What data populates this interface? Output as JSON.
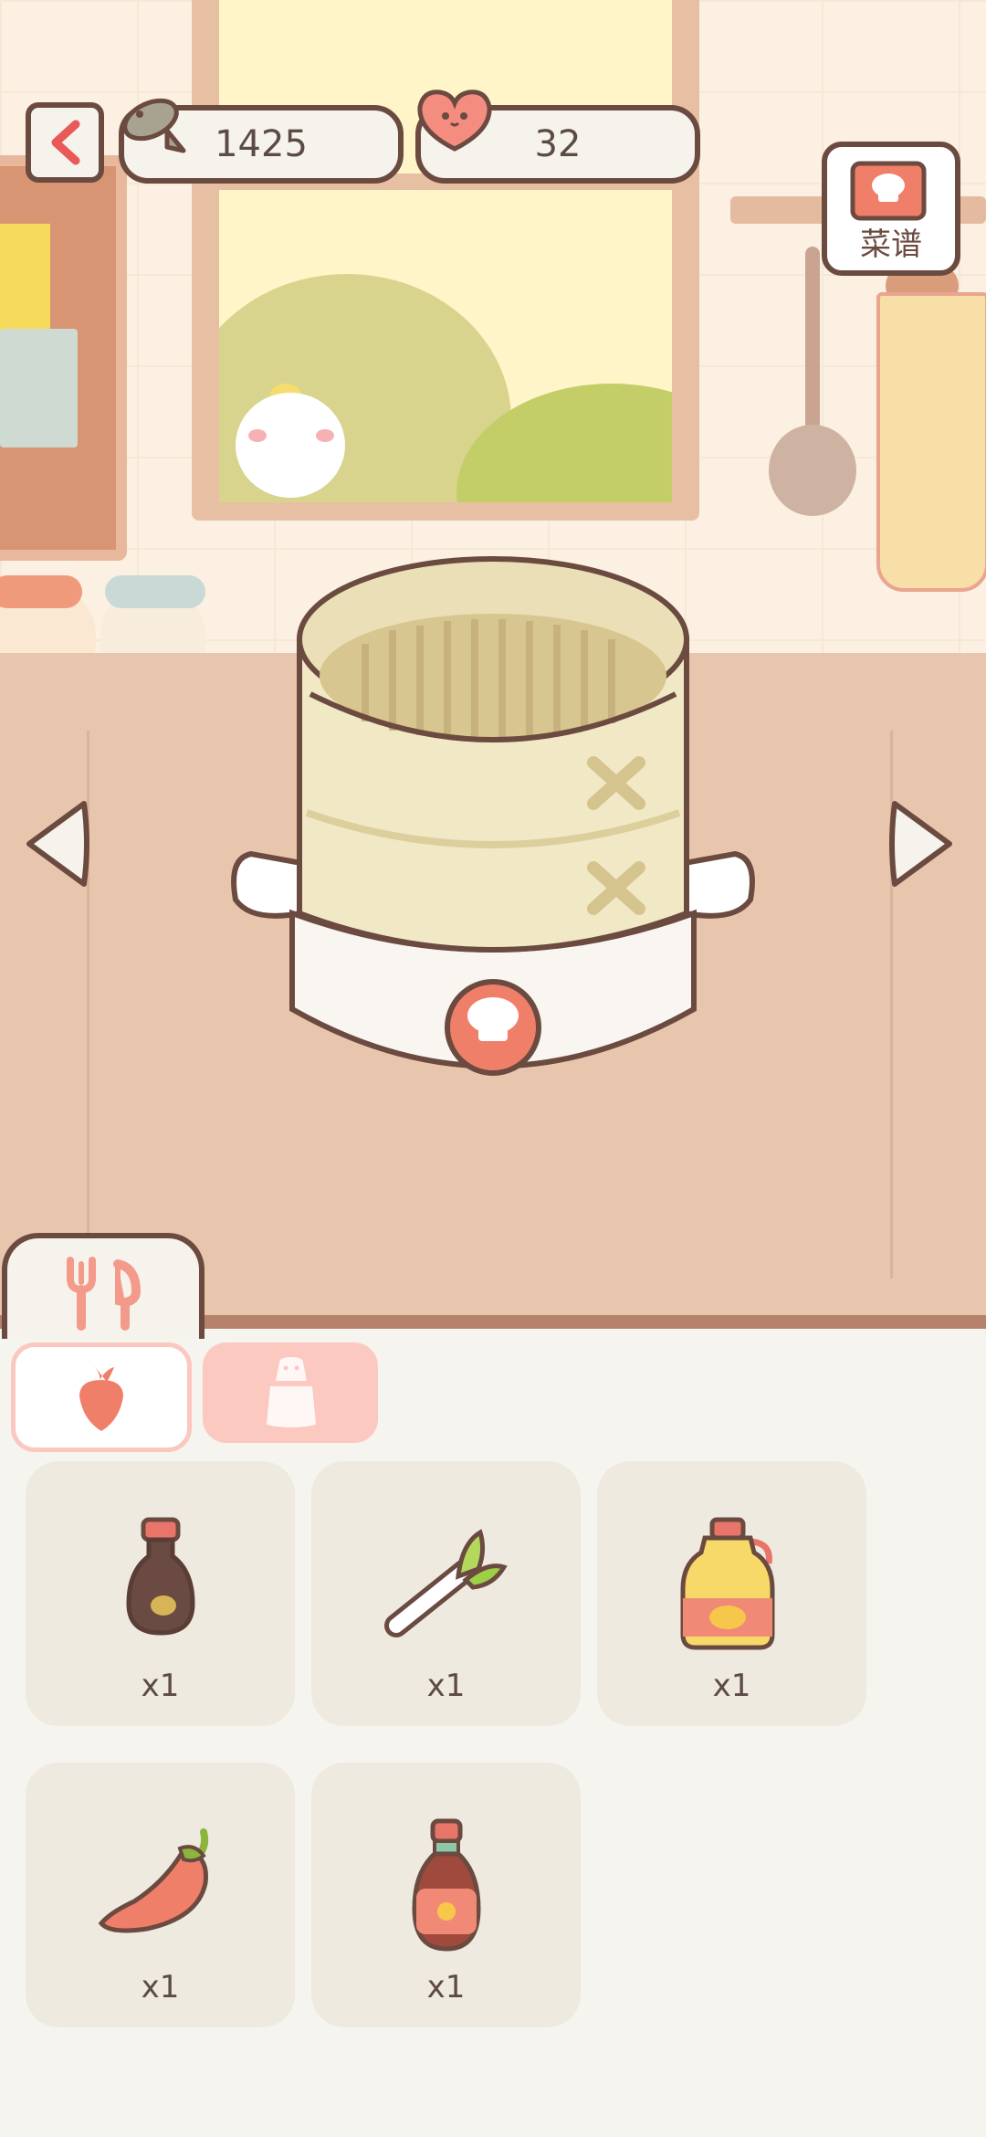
{
  "hud": {
    "fish_currency": "1425",
    "heart_currency": "32",
    "recipe_label": "菜谱"
  },
  "cooking_station": {
    "appliance": "bamboo-steamer",
    "cook_button_icon": "chef-hat-icon"
  },
  "bottom_tabs": {
    "tools_tab_icon": "fork-spoon-icon",
    "categories": [
      {
        "icon": "carrot-icon",
        "active": true
      },
      {
        "icon": "salt-shaker-icon",
        "active": false
      }
    ]
  },
  "inventory": [
    {
      "item": "soy-sauce-bottle",
      "count": "x1"
    },
    {
      "item": "green-onion",
      "count": "x1"
    },
    {
      "item": "cooking-oil",
      "count": "x1"
    },
    {
      "item": "chili-pepper",
      "count": "x1"
    },
    {
      "item": "hot-sauce-bottle",
      "count": "x1"
    }
  ],
  "colors": {
    "outline": "#6b4a40",
    "accent_pink": "#f07f6a",
    "counter": "#e8c6ae",
    "panel_bg": "#f6f4ef",
    "slot_bg": "#eeeae0"
  }
}
